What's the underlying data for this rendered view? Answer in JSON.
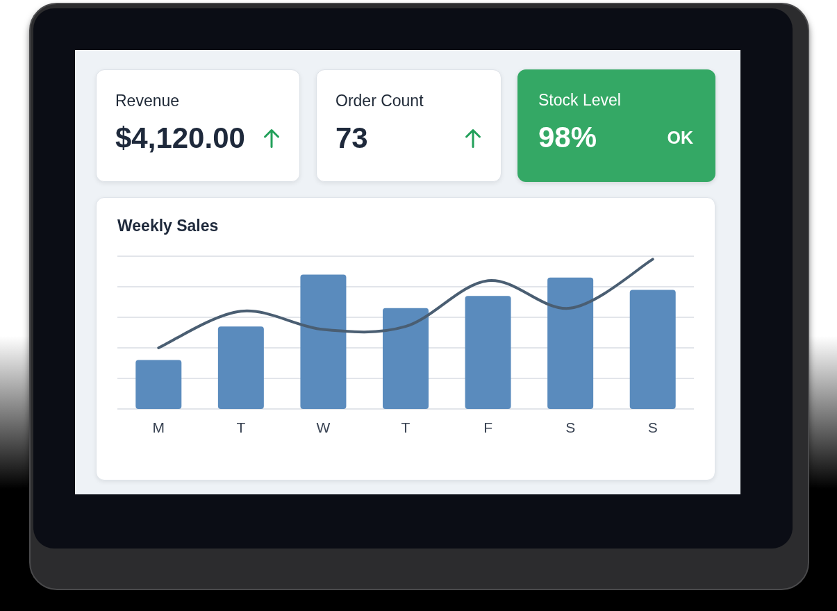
{
  "cards": [
    {
      "kind": "trend",
      "label": "Revenue",
      "value": "$4,120.00",
      "rising": true
    },
    {
      "kind": "trend",
      "label": "Order Count",
      "value": "73",
      "rising": true
    },
    {
      "kind": "status",
      "label": "Stock Level",
      "value": "98%",
      "status": "OK",
      "color": "#34a865"
    }
  ],
  "sales_panel": {
    "title": "Weekly Sales",
    "day_labels": [
      "M",
      "T",
      "W",
      "T",
      "F",
      "S",
      "S"
    ]
  }
}
